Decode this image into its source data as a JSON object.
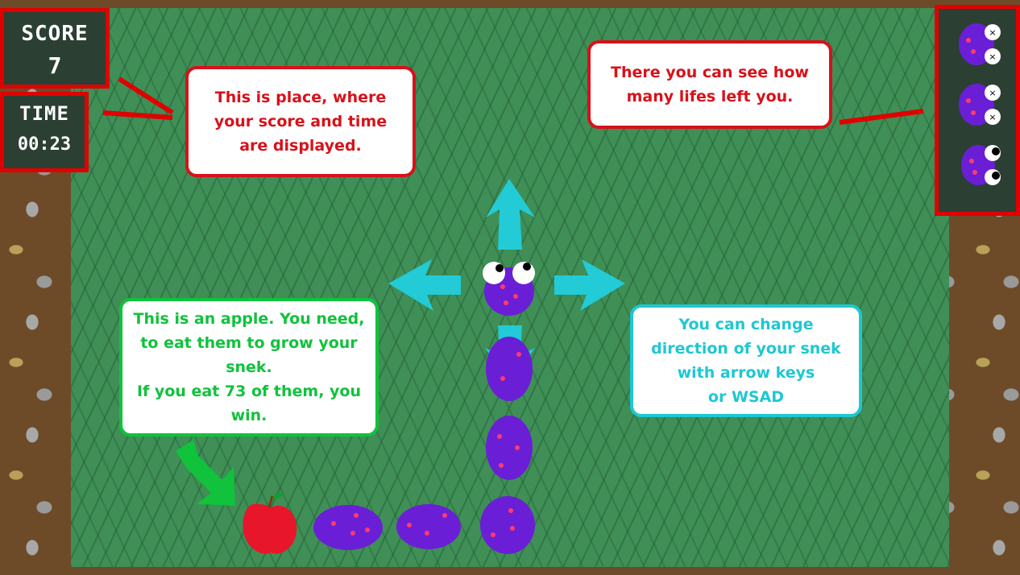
{
  "hud": {
    "score_label": "SCORE",
    "score_value": "7",
    "time_label": "TIME",
    "time_value": "00:23",
    "lives_total": 3,
    "lives_lost": 2
  },
  "tips": {
    "score_time": "This is place, where\nyour score  and time\nare displayed.",
    "lives": "There you can see how\nmany lifes left you.",
    "apple": "This is an apple. You need,\nto eat them to grow your\nsnek.\nIf you eat 73 of them, you\nwin.",
    "direction": "You can change\ndirection of your snek\nwith arrow keys\nor WSAD"
  },
  "colors": {
    "field": "#3f8f57",
    "hud_border": "#e00000",
    "tip_red": "#d8111a",
    "tip_green": "#10c23c",
    "tip_cyan": "#1fc7d2",
    "snake_body": "#6a1fd6",
    "apple": "#e8162a"
  }
}
